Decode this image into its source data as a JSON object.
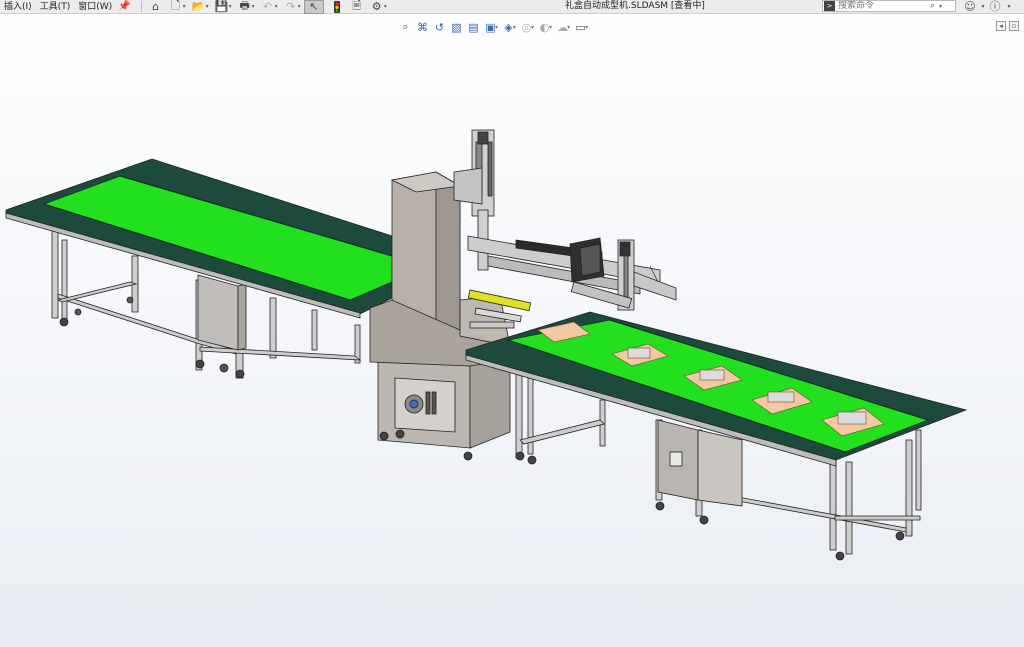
{
  "menu": {
    "items": [
      {
        "label": "插入(I)"
      },
      {
        "label": "工具(T)"
      },
      {
        "label": "窗口(W)"
      }
    ]
  },
  "toolbar": {
    "icons": [
      "pin-icon",
      "home-icon",
      "new-file-icon",
      "open-file-icon",
      "save-icon",
      "print-icon",
      "undo-icon",
      "redo-icon",
      "select-icon",
      "rebuild-icon",
      "file-properties-icon",
      "options-icon"
    ],
    "active": "select-icon"
  },
  "document": {
    "title": "礼盒自动成型机.SLDASM [查看中]"
  },
  "search": {
    "placeholder": "搜索命令",
    "value": ""
  },
  "hud_toolbar": {
    "icons": [
      "zoom-to-fit-icon",
      "zoom-to-area-icon",
      "previous-view-icon",
      "section-view-icon",
      "dynamic-annotation-icon",
      "view-orientation-icon",
      "display-style-icon",
      "hide-show-items-icon",
      "edit-appearance-icon",
      "apply-scene-icon",
      "view-settings-icon"
    ]
  },
  "colors": {
    "belt_green": "#22e01e",
    "belt_dark": "#1d4a3c",
    "frame": "#c9c9c9",
    "cabinet": "#b3aca6",
    "carton": "#f2c9a3"
  }
}
